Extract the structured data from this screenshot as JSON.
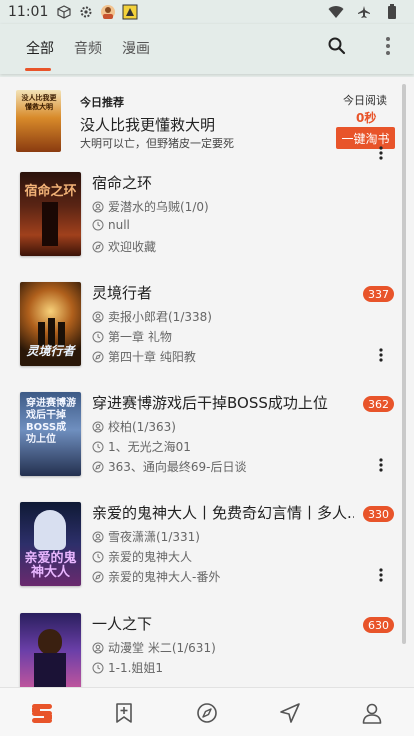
{
  "status_bar": {
    "time": "11:01"
  },
  "tabs": [
    {
      "label": "全部",
      "active": true
    },
    {
      "label": "音频",
      "active": false
    },
    {
      "label": "漫画",
      "active": false
    }
  ],
  "recommendation": {
    "label": "今日推荐",
    "title": "没人比我更懂救大明",
    "subtitle": "大明可以亡，但野猪皮一定要死",
    "cover_text": "没人比我更懂救大明",
    "today_read_label": "今日阅读",
    "today_read_value": "0秒",
    "button_label": "一键淘书"
  },
  "books": [
    {
      "title": "宿命之环",
      "author_line": "爱潜水的乌贼(1/0)",
      "latest": "null",
      "status": "欢迎收藏",
      "badge": "",
      "cover_text": "宿命之环"
    },
    {
      "title": "灵境行者",
      "author_line": "卖报小郎君(1/338)",
      "latest": "第一章 礼物",
      "status": "第四十章 纯阳教",
      "badge": "337",
      "cover_text": "灵境行者"
    },
    {
      "title": "穿进赛博游戏后干掉BOSS成功上位",
      "author_line": "校柏(1/363)",
      "latest": "1、无光之海01",
      "status": "363、通向最终69-后日谈",
      "badge": "362",
      "cover_text": "穿进赛博游戏后干掉BOSS成功上位"
    },
    {
      "title": "亲爱的鬼神大人丨免费奇幻言情丨多人...",
      "author_line": "雪夜潇潇(1/331)",
      "latest": "亲爱的鬼神大人",
      "status": "亲爱的鬼神大人-番外",
      "badge": "330",
      "cover_text": "亲爱的鬼神大人"
    },
    {
      "title": "一人之下",
      "author_line": "动漫堂 米二(1/631)",
      "latest": "1-1.姐姐1",
      "status": "",
      "badge": "630",
      "cover_text": ""
    }
  ],
  "colors": {
    "accent": "#e8542a",
    "background": "#f4f4f4",
    "header": "#e4ece9"
  },
  "icons": {
    "status": [
      "cube-icon",
      "gear-icon",
      "avatar-icon",
      "game-icon",
      "wifi-icon",
      "airplane-icon",
      "battery-icon"
    ],
    "appbar": [
      "search-icon",
      "more-vertical-icon"
    ],
    "bottom_nav": [
      "bookshelf-icon",
      "bookmark-add-icon",
      "compass-icon",
      "send-icon",
      "person-icon"
    ]
  }
}
